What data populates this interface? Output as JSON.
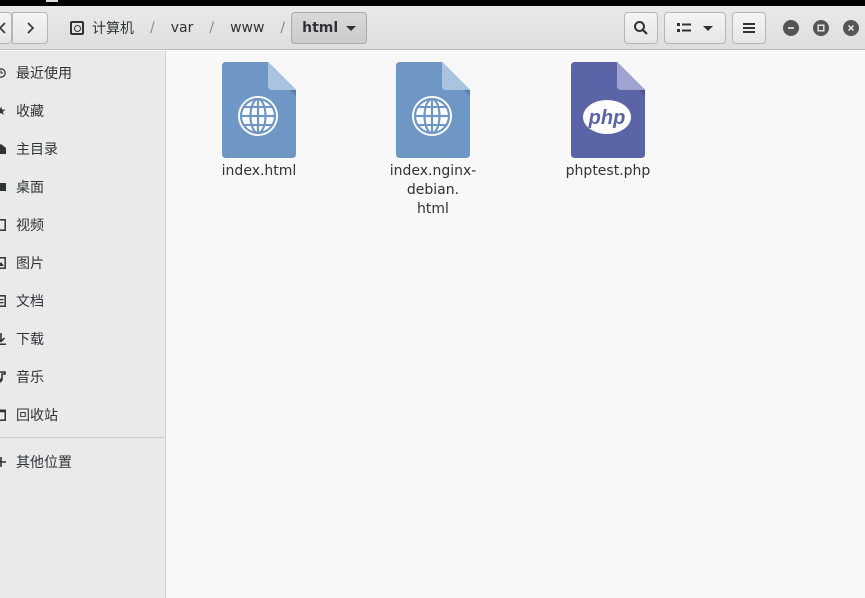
{
  "breadcrumb": {
    "items": [
      "计算机",
      "var",
      "www",
      "html"
    ],
    "separator": "/"
  },
  "header": {
    "search_icon": "search-icon",
    "view_icon": "list-view-icon",
    "menu_icon": "hamburger-icon"
  },
  "sidebar": {
    "items": [
      {
        "label": "最近使用",
        "icon": "clock-icon"
      },
      {
        "label": "收藏",
        "icon": "star-icon"
      },
      {
        "label": "主目录",
        "icon": "home-icon"
      },
      {
        "label": "桌面",
        "icon": "desktop-icon"
      },
      {
        "label": "视频",
        "icon": "video-icon"
      },
      {
        "label": "图片",
        "icon": "image-icon"
      },
      {
        "label": "文档",
        "icon": "document-icon"
      },
      {
        "label": "下载",
        "icon": "download-icon"
      },
      {
        "label": "音乐",
        "icon": "music-icon"
      },
      {
        "label": "回收站",
        "icon": "trash-icon"
      },
      {
        "label": "其他位置",
        "icon": "plus-icon"
      }
    ]
  },
  "files": [
    {
      "name": "index.html",
      "type": "html",
      "color": "#6f97c6"
    },
    {
      "name": "index.nginx-debian.\nhtml",
      "type": "html",
      "color": "#6f97c6"
    },
    {
      "name": "phptest.php",
      "type": "php",
      "color": "#5a64a6"
    }
  ],
  "colors": {
    "html_file": "#6f97c6",
    "php_file": "#5a64a6",
    "sidebar_bg": "#eaeaeb",
    "content_bg": "#f8f8f9"
  }
}
